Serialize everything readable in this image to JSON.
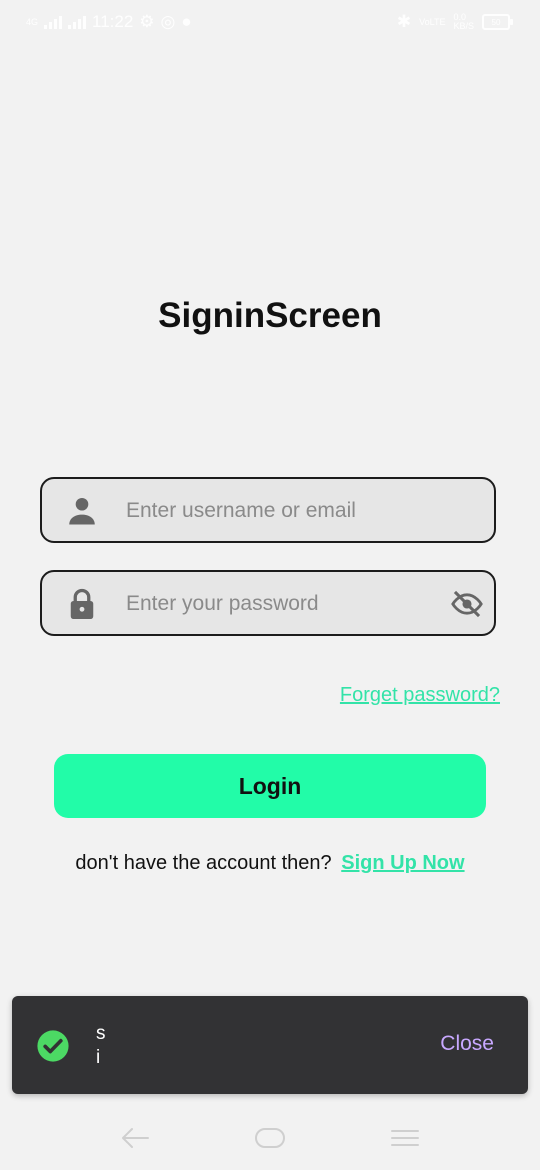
{
  "status_bar": {
    "time": "11:22",
    "network_tag": "4G",
    "speed_top": "0.0",
    "speed_bottom": "KB/S",
    "battery": "50"
  },
  "screen": {
    "title": "SigninScreen"
  },
  "form": {
    "username": {
      "icon": "person-icon",
      "placeholder": "Enter username or email",
      "value": ""
    },
    "password": {
      "icon": "lock-icon",
      "placeholder": "Enter your password",
      "value": "",
      "visibility_icon": "eye-off-icon"
    },
    "forgot_label": "Forget password?",
    "login_label": "Login",
    "signup_prompt": "don't have the account then?",
    "signup_link": "Sign Up Now"
  },
  "snackbar": {
    "icon": "check-circle-icon",
    "message": "si",
    "close_label": "Close"
  },
  "colors": {
    "accent": "#22fca8",
    "link": "#33e3a8",
    "background": "#f2f2f2",
    "field_bg": "#e6e6e6",
    "snackbar_bg": "#323234",
    "snackbar_action": "#c8a8ff",
    "success": "#4cd964"
  }
}
